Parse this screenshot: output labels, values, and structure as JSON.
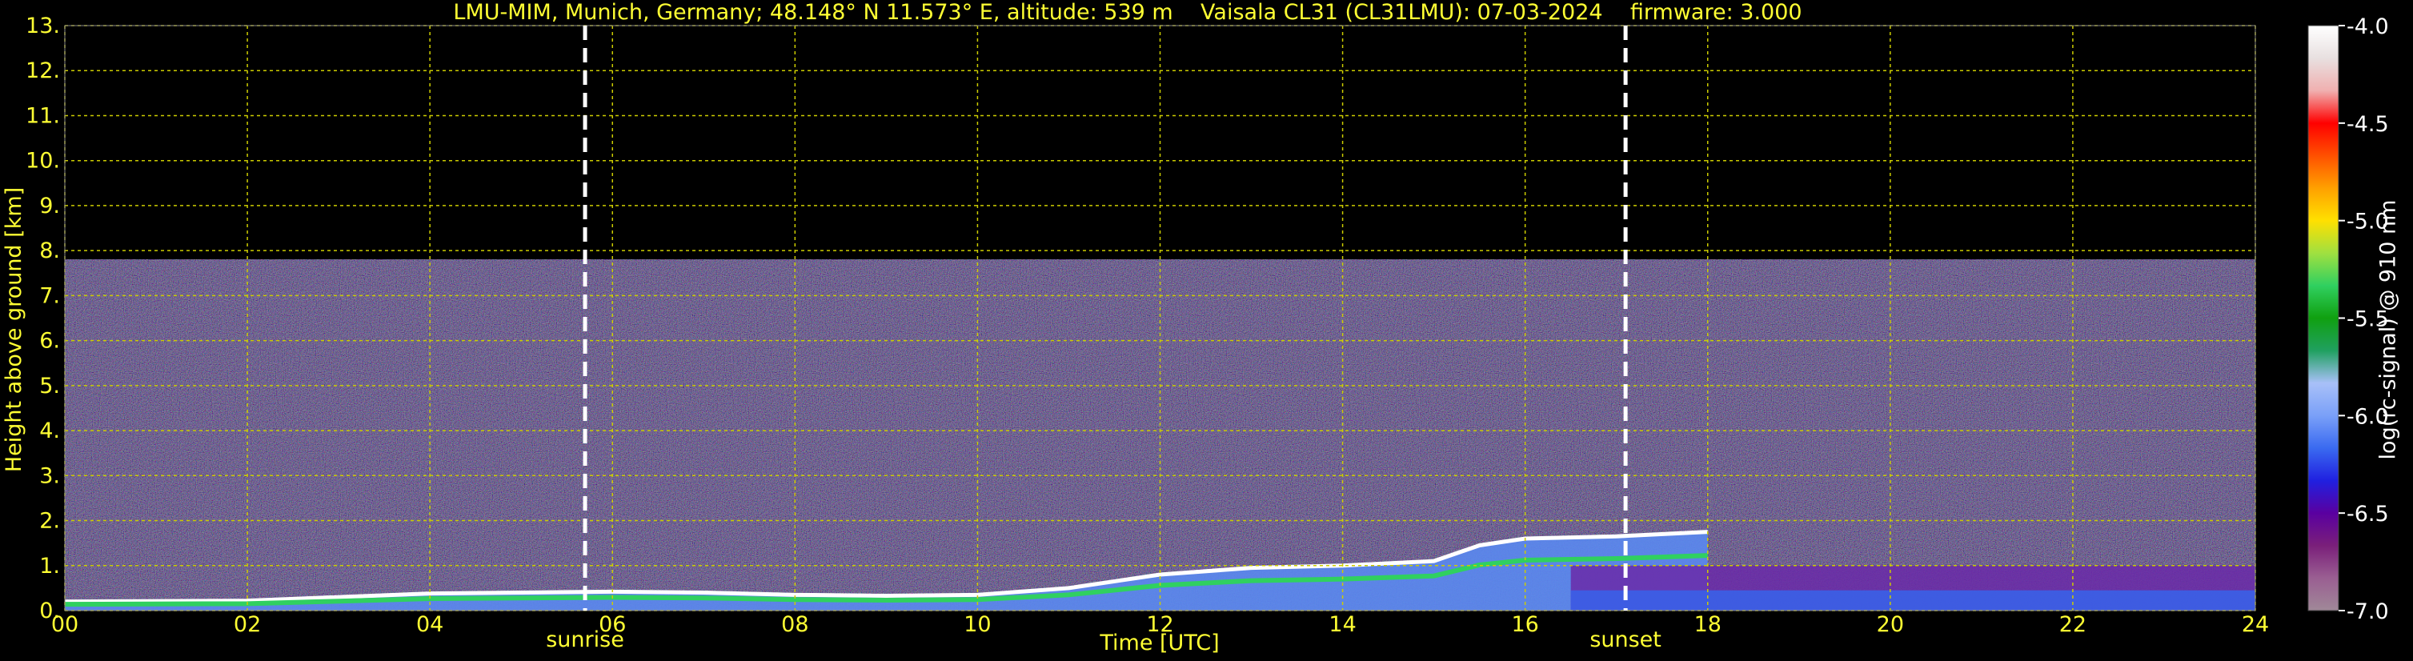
{
  "title_left": "LMU-MIM, Munich, Germany; 48.148° N 11.573° E, altitude: 539 m",
  "title_mid": "Vaisala CL31 (CL31LMU): 07-03-2024",
  "title_right": "firmware: 3.000",
  "colors": {
    "text": "#ffff33",
    "grid": "#cccc00",
    "background": "#000000",
    "event_line": "#ffffff"
  },
  "chart_data": {
    "type": "heatmap",
    "xlabel": "Time [UTC]",
    "ylabel": "Height above ground [km]",
    "xlim": [
      0,
      24
    ],
    "ylim": [
      0,
      13
    ],
    "x_ticks": [
      "00",
      "02",
      "04",
      "06",
      "08",
      "10",
      "12",
      "14",
      "16",
      "18",
      "20",
      "22",
      "24"
    ],
    "y_ticks": [
      "0.",
      "1.",
      "2.",
      "3.",
      "4.",
      "5.",
      "6.",
      "7.",
      "8.",
      "9.",
      "10.",
      "11.",
      "12.",
      "13."
    ],
    "grid": true,
    "events": [
      {
        "label": "sunrise",
        "time": 5.7
      },
      {
        "label": "sunset",
        "time": 17.1
      }
    ],
    "colorbar": {
      "label": "log(rc-signal) @ 910 nm",
      "range": [
        -7.0,
        -4.0
      ],
      "ticks": [
        "-4.0",
        "-4.5",
        "-5.0",
        "-5.5",
        "-6.0",
        "-6.5",
        "-7.0"
      ],
      "stops": [
        "#a08898",
        "#9a5f92",
        "#7a1f7a",
        "#5a00a0",
        "#2020e0",
        "#3a6af0",
        "#7aa0f8",
        "#a8c0f8",
        "#20a060",
        "#10a010",
        "#30d060",
        "#a0e040",
        "#ffe000",
        "#ffa000",
        "#ff5000",
        "#ff0000",
        "#f0b0b0",
        "#e8e0e0",
        "#ffffff"
      ]
    },
    "boundary_layer_top_km": [
      [
        0,
        0.2
      ],
      [
        2,
        0.22
      ],
      [
        3,
        0.3
      ],
      [
        4,
        0.38
      ],
      [
        5,
        0.4
      ],
      [
        6,
        0.42
      ],
      [
        7,
        0.4
      ],
      [
        8,
        0.35
      ],
      [
        9,
        0.33
      ],
      [
        10,
        0.35
      ],
      [
        11,
        0.5
      ],
      [
        12,
        0.8
      ],
      [
        13,
        0.95
      ],
      [
        14,
        1.0
      ],
      [
        15,
        1.1
      ],
      [
        15.5,
        1.45
      ],
      [
        16,
        1.6
      ],
      [
        17,
        1.65
      ],
      [
        18,
        1.75
      ]
    ]
  }
}
